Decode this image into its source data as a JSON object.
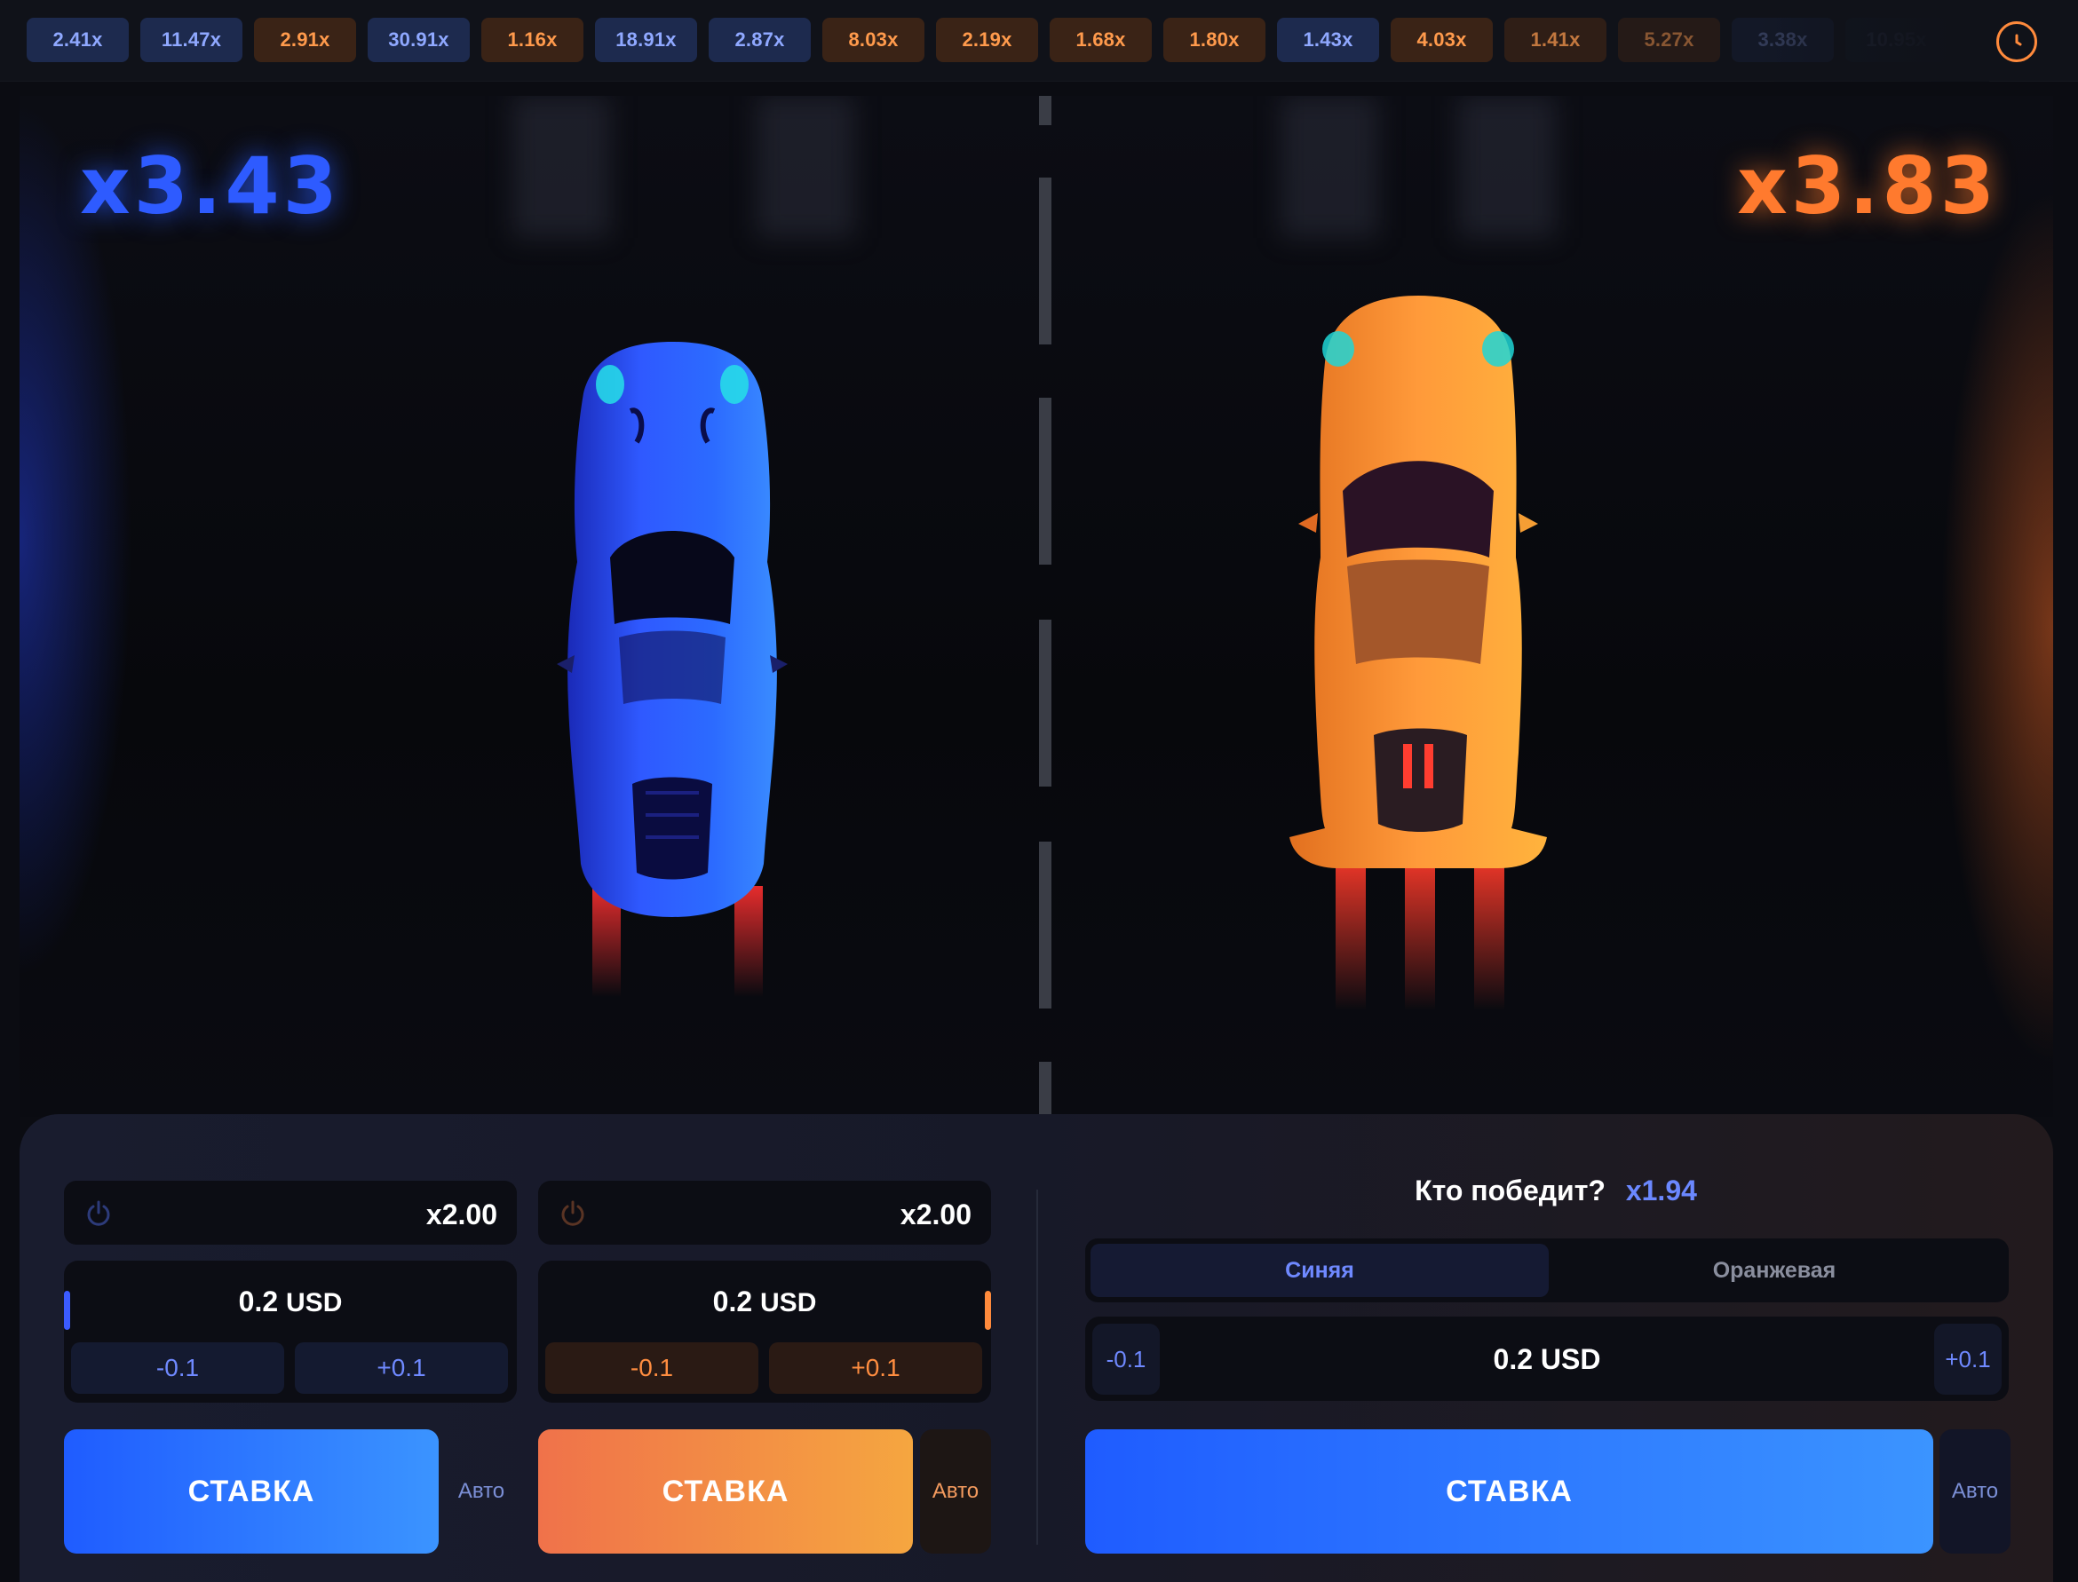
{
  "history": [
    {
      "label": "2.41x",
      "side": "blue"
    },
    {
      "label": "11.47x",
      "side": "blue"
    },
    {
      "label": "2.91x",
      "side": "orange"
    },
    {
      "label": "30.91x",
      "side": "blue"
    },
    {
      "label": "1.16x",
      "side": "orange"
    },
    {
      "label": "18.91x",
      "side": "blue"
    },
    {
      "label": "2.87x",
      "side": "blue"
    },
    {
      "label": "8.03x",
      "side": "orange"
    },
    {
      "label": "2.19x",
      "side": "orange"
    },
    {
      "label": "1.68x",
      "side": "orange"
    },
    {
      "label": "1.80x",
      "side": "orange"
    },
    {
      "label": "1.43x",
      "side": "blue"
    },
    {
      "label": "4.03x",
      "side": "orange"
    },
    {
      "label": "1.41x",
      "side": "orange"
    },
    {
      "label": "5.27x",
      "side": "orange"
    },
    {
      "label": "3.38x",
      "side": "blue"
    },
    {
      "label": "10.95x",
      "side": "blue"
    }
  ],
  "game": {
    "blue_multiplier": "x3.43",
    "orange_multiplier": "x3.83"
  },
  "bets": {
    "blue": {
      "autocashout": "x2.00",
      "amount": "0.2",
      "currency": "USD",
      "minus": "-0.1",
      "plus": "+0.1",
      "bet_label": "СТАВКА",
      "auto_label": "Авто"
    },
    "orange": {
      "autocashout": "x2.00",
      "amount": "0.2",
      "currency": "USD",
      "minus": "-0.1",
      "plus": "+0.1",
      "bet_label": "СТАВКА",
      "auto_label": "Авто"
    },
    "winner": {
      "question": "Кто победит?",
      "multiplier": "x1.94",
      "team_blue": "Синяя",
      "team_orange": "Оранжевая",
      "amount": "0.2",
      "currency": "USD",
      "minus": "-0.1",
      "plus": "+0.1",
      "bet_label": "СТАВКА",
      "auto_label": "Авто"
    }
  },
  "colors": {
    "blue": "#2e5bff",
    "orange": "#ff7a2e",
    "background": "#0b0c12"
  },
  "icons": {
    "history": "clock-icon",
    "power": "power-icon"
  }
}
